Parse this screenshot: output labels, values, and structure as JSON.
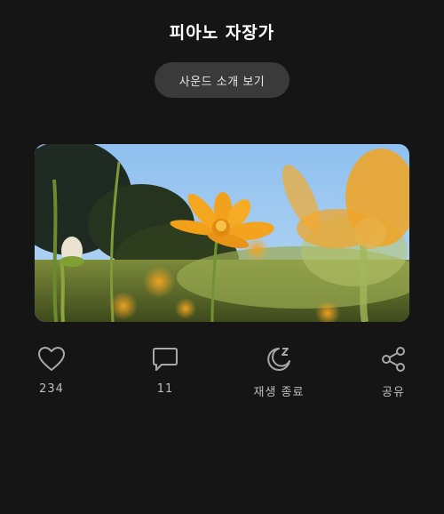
{
  "header": {
    "title": "피아노 자장가"
  },
  "intro_button": {
    "label": "사운드 소개 보기"
  },
  "hero": {
    "image_icon": "cosmos-flower-photo"
  },
  "actions": [
    {
      "icon": "heart-icon",
      "label": "234"
    },
    {
      "icon": "comment-icon",
      "label": "11"
    },
    {
      "icon": "sleep-moon-icon",
      "label": "재생 종료"
    },
    {
      "icon": "share-icon",
      "label": "공유"
    }
  ],
  "colors": {
    "background": "#151515",
    "button_bg": "#3a3a3a",
    "icon_gray": "#a8a8a8",
    "flower_orange": "#f2a21e"
  }
}
